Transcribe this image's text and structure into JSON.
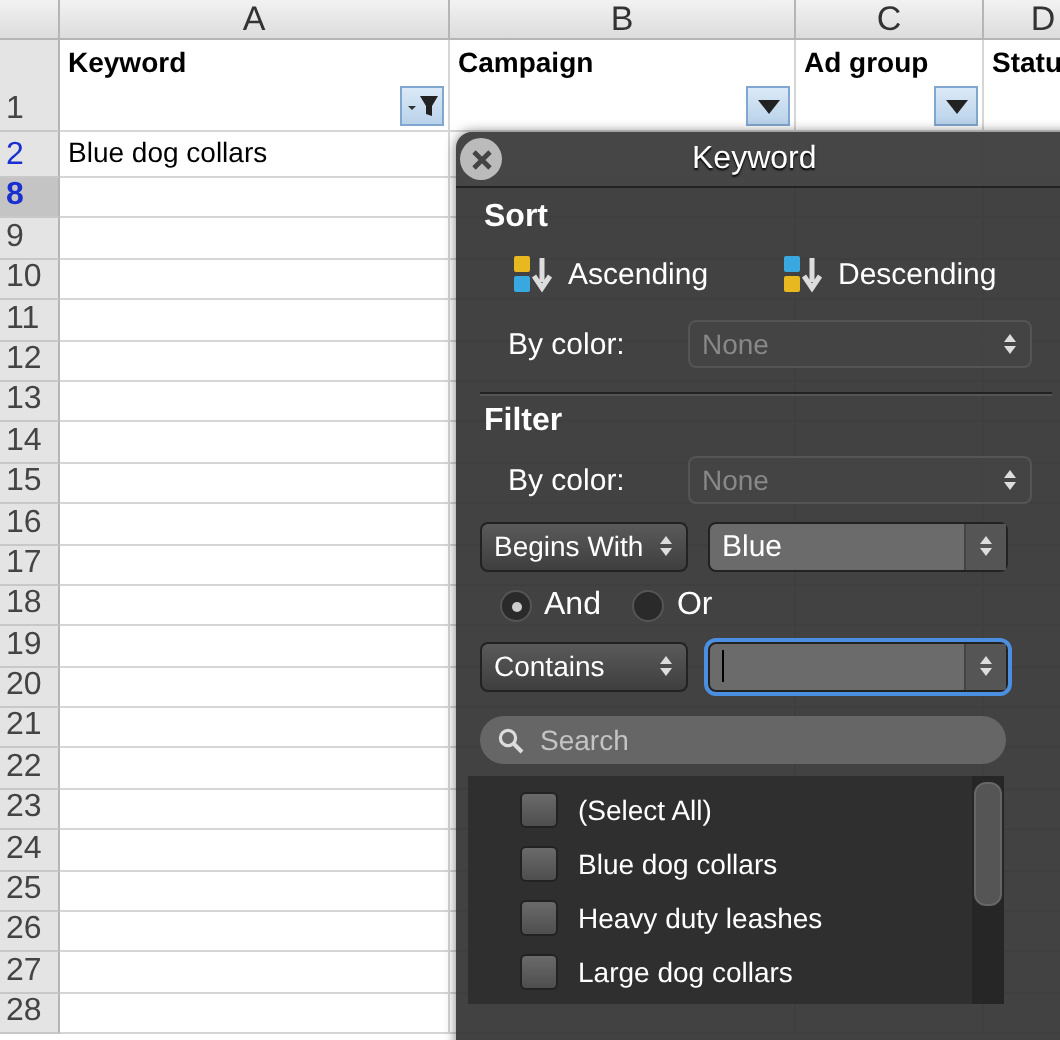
{
  "sheet": {
    "columns": [
      {
        "letter": "A"
      },
      {
        "letter": "B"
      },
      {
        "letter": "C"
      },
      {
        "letter": "D"
      }
    ],
    "header_row": {
      "number": "1",
      "cells": [
        {
          "text": "Keyword",
          "kind": "filtered"
        },
        {
          "text": "Campaign",
          "kind": "dropdown"
        },
        {
          "text": "Ad group",
          "kind": "dropdown"
        },
        {
          "text": "Statu",
          "kind": "plain"
        }
      ]
    },
    "rows": [
      {
        "number": "2",
        "filtered": true,
        "selected": false,
        "cells": [
          "Blue dog collars"
        ]
      },
      {
        "number": "8",
        "filtered": true,
        "selected": true,
        "cells": []
      },
      {
        "number": "9",
        "filtered": false,
        "selected": false,
        "cells": []
      },
      {
        "number": "10",
        "filtered": false,
        "selected": false,
        "cells": []
      },
      {
        "number": "11",
        "filtered": false,
        "selected": false,
        "cells": []
      },
      {
        "number": "12",
        "filtered": false,
        "selected": false,
        "cells": []
      },
      {
        "number": "13",
        "filtered": false,
        "selected": false,
        "cells": []
      },
      {
        "number": "14",
        "filtered": false,
        "selected": false,
        "cells": []
      },
      {
        "number": "15",
        "filtered": false,
        "selected": false,
        "cells": []
      },
      {
        "number": "16",
        "filtered": false,
        "selected": false,
        "cells": []
      },
      {
        "number": "17",
        "filtered": false,
        "selected": false,
        "cells": []
      },
      {
        "number": "18",
        "filtered": false,
        "selected": false,
        "cells": []
      },
      {
        "number": "19",
        "filtered": false,
        "selected": false,
        "cells": []
      },
      {
        "number": "20",
        "filtered": false,
        "selected": false,
        "cells": []
      },
      {
        "number": "21",
        "filtered": false,
        "selected": false,
        "cells": []
      },
      {
        "number": "22",
        "filtered": false,
        "selected": false,
        "cells": []
      },
      {
        "number": "23",
        "filtered": false,
        "selected": false,
        "cells": []
      },
      {
        "number": "24",
        "filtered": false,
        "selected": false,
        "cells": []
      },
      {
        "number": "25",
        "filtered": false,
        "selected": false,
        "cells": []
      },
      {
        "number": "26",
        "filtered": false,
        "selected": false,
        "cells": []
      },
      {
        "number": "27",
        "filtered": false,
        "selected": false,
        "cells": []
      },
      {
        "number": "28",
        "filtered": false,
        "selected": false,
        "cells": []
      }
    ]
  },
  "panel": {
    "title": "Keyword",
    "sort": {
      "heading": "Sort",
      "ascending": "Ascending",
      "descending": "Descending",
      "by_color_label": "By color:",
      "by_color_value": "None",
      "by_color_disabled": true
    },
    "filter": {
      "heading": "Filter",
      "by_color_label": "By color:",
      "by_color_value": "None",
      "by_color_disabled": true,
      "condition_1": {
        "operator": "Begins With",
        "value": "Blue",
        "focused": false
      },
      "joins": [
        {
          "label": "And",
          "selected": true
        },
        {
          "label": "Or",
          "selected": false
        }
      ],
      "condition_2": {
        "operator": "Contains",
        "focused": true
      },
      "search": {
        "placeholder": "Search"
      },
      "items": [
        {
          "label": "(Select All)",
          "checked": false
        },
        {
          "label": "Blue dog collars",
          "checked": false
        },
        {
          "label": "Heavy duty leashes",
          "checked": false
        },
        {
          "label": "Large dog collars",
          "checked": false
        }
      ]
    }
  }
}
